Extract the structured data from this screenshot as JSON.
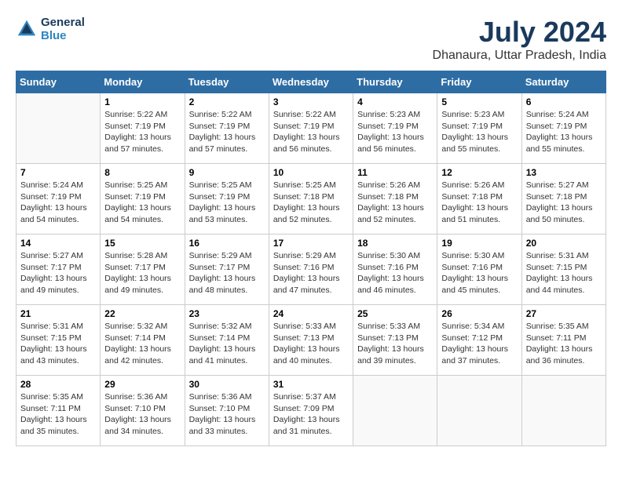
{
  "header": {
    "logo_line1": "General",
    "logo_line2": "Blue",
    "month_year": "July 2024",
    "location": "Dhanaura, Uttar Pradesh, India"
  },
  "days_of_week": [
    "Sunday",
    "Monday",
    "Tuesday",
    "Wednesday",
    "Thursday",
    "Friday",
    "Saturday"
  ],
  "weeks": [
    [
      {
        "day": "",
        "info": ""
      },
      {
        "day": "1",
        "info": "Sunrise: 5:22 AM\nSunset: 7:19 PM\nDaylight: 13 hours\nand 57 minutes."
      },
      {
        "day": "2",
        "info": "Sunrise: 5:22 AM\nSunset: 7:19 PM\nDaylight: 13 hours\nand 57 minutes."
      },
      {
        "day": "3",
        "info": "Sunrise: 5:22 AM\nSunset: 7:19 PM\nDaylight: 13 hours\nand 56 minutes."
      },
      {
        "day": "4",
        "info": "Sunrise: 5:23 AM\nSunset: 7:19 PM\nDaylight: 13 hours\nand 56 minutes."
      },
      {
        "day": "5",
        "info": "Sunrise: 5:23 AM\nSunset: 7:19 PM\nDaylight: 13 hours\nand 55 minutes."
      },
      {
        "day": "6",
        "info": "Sunrise: 5:24 AM\nSunset: 7:19 PM\nDaylight: 13 hours\nand 55 minutes."
      }
    ],
    [
      {
        "day": "7",
        "info": "Sunrise: 5:24 AM\nSunset: 7:19 PM\nDaylight: 13 hours\nand 54 minutes."
      },
      {
        "day": "8",
        "info": "Sunrise: 5:25 AM\nSunset: 7:19 PM\nDaylight: 13 hours\nand 54 minutes."
      },
      {
        "day": "9",
        "info": "Sunrise: 5:25 AM\nSunset: 7:19 PM\nDaylight: 13 hours\nand 53 minutes."
      },
      {
        "day": "10",
        "info": "Sunrise: 5:25 AM\nSunset: 7:18 PM\nDaylight: 13 hours\nand 52 minutes."
      },
      {
        "day": "11",
        "info": "Sunrise: 5:26 AM\nSunset: 7:18 PM\nDaylight: 13 hours\nand 52 minutes."
      },
      {
        "day": "12",
        "info": "Sunrise: 5:26 AM\nSunset: 7:18 PM\nDaylight: 13 hours\nand 51 minutes."
      },
      {
        "day": "13",
        "info": "Sunrise: 5:27 AM\nSunset: 7:18 PM\nDaylight: 13 hours\nand 50 minutes."
      }
    ],
    [
      {
        "day": "14",
        "info": "Sunrise: 5:27 AM\nSunset: 7:17 PM\nDaylight: 13 hours\nand 49 minutes."
      },
      {
        "day": "15",
        "info": "Sunrise: 5:28 AM\nSunset: 7:17 PM\nDaylight: 13 hours\nand 49 minutes."
      },
      {
        "day": "16",
        "info": "Sunrise: 5:29 AM\nSunset: 7:17 PM\nDaylight: 13 hours\nand 48 minutes."
      },
      {
        "day": "17",
        "info": "Sunrise: 5:29 AM\nSunset: 7:16 PM\nDaylight: 13 hours\nand 47 minutes."
      },
      {
        "day": "18",
        "info": "Sunrise: 5:30 AM\nSunset: 7:16 PM\nDaylight: 13 hours\nand 46 minutes."
      },
      {
        "day": "19",
        "info": "Sunrise: 5:30 AM\nSunset: 7:16 PM\nDaylight: 13 hours\nand 45 minutes."
      },
      {
        "day": "20",
        "info": "Sunrise: 5:31 AM\nSunset: 7:15 PM\nDaylight: 13 hours\nand 44 minutes."
      }
    ],
    [
      {
        "day": "21",
        "info": "Sunrise: 5:31 AM\nSunset: 7:15 PM\nDaylight: 13 hours\nand 43 minutes."
      },
      {
        "day": "22",
        "info": "Sunrise: 5:32 AM\nSunset: 7:14 PM\nDaylight: 13 hours\nand 42 minutes."
      },
      {
        "day": "23",
        "info": "Sunrise: 5:32 AM\nSunset: 7:14 PM\nDaylight: 13 hours\nand 41 minutes."
      },
      {
        "day": "24",
        "info": "Sunrise: 5:33 AM\nSunset: 7:13 PM\nDaylight: 13 hours\nand 40 minutes."
      },
      {
        "day": "25",
        "info": "Sunrise: 5:33 AM\nSunset: 7:13 PM\nDaylight: 13 hours\nand 39 minutes."
      },
      {
        "day": "26",
        "info": "Sunrise: 5:34 AM\nSunset: 7:12 PM\nDaylight: 13 hours\nand 37 minutes."
      },
      {
        "day": "27",
        "info": "Sunrise: 5:35 AM\nSunset: 7:11 PM\nDaylight: 13 hours\nand 36 minutes."
      }
    ],
    [
      {
        "day": "28",
        "info": "Sunrise: 5:35 AM\nSunset: 7:11 PM\nDaylight: 13 hours\nand 35 minutes."
      },
      {
        "day": "29",
        "info": "Sunrise: 5:36 AM\nSunset: 7:10 PM\nDaylight: 13 hours\nand 34 minutes."
      },
      {
        "day": "30",
        "info": "Sunrise: 5:36 AM\nSunset: 7:10 PM\nDaylight: 13 hours\nand 33 minutes."
      },
      {
        "day": "31",
        "info": "Sunrise: 5:37 AM\nSunset: 7:09 PM\nDaylight: 13 hours\nand 31 minutes."
      },
      {
        "day": "",
        "info": ""
      },
      {
        "day": "",
        "info": ""
      },
      {
        "day": "",
        "info": ""
      }
    ]
  ]
}
